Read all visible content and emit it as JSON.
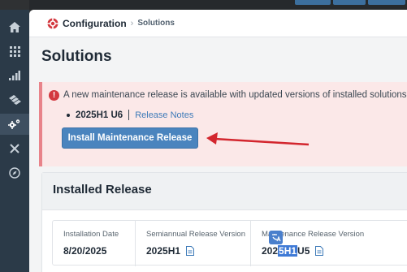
{
  "breadcrumb": {
    "root": "Configuration",
    "separator": "›",
    "leaf": "Solutions"
  },
  "page": {
    "title": "Solutions"
  },
  "alert": {
    "icon_text": "!",
    "message": "A new maintenance release is available with updated versions of installed solutions.",
    "release_version": "2025H1 U6",
    "release_notes_label": "Release Notes",
    "install_button_label": "Install Maintenance Release"
  },
  "installed": {
    "title": "Installed Release",
    "installation_date_label": "Installation Date",
    "installation_date": "8/20/2025",
    "semiannual_label": "Semiannual Release Version",
    "semiannual_version": "2025H1",
    "maintenance_label": "Maintenance Release Version",
    "maintenance_version_prefix": "202",
    "maintenance_version_highlight": "5H1",
    "maintenance_version_suffix": " U5"
  },
  "nav": {
    "items": [
      "home-icon",
      "apps-grid-icon",
      "analytics-icon",
      "layers-icon",
      "settings-icon",
      "tools-icon",
      "compass-icon"
    ],
    "active": "settings-icon"
  },
  "colors": {
    "rail": "#2b3a48",
    "accent": "#4a84be",
    "alert_bg": "#fbe8e8",
    "alert_icon": "#d3383f",
    "arrow": "#d3262e",
    "highlight": "#3f7ad6"
  }
}
